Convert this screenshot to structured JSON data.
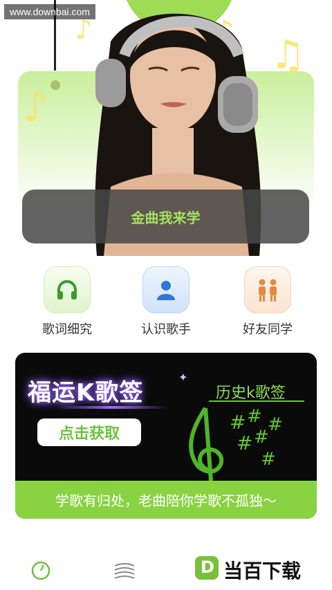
{
  "watermark": "www.downbai.com",
  "hero": {
    "banner_text": "金曲我来学"
  },
  "features": [
    {
      "label": "歌词细究",
      "icon": "headphones-icon"
    },
    {
      "label": "认识歌手",
      "icon": "person-icon"
    },
    {
      "label": "好友同学",
      "icon": "friends-icon"
    }
  ],
  "promo": {
    "title": "福运K歌签",
    "button_label": "点击获取",
    "history_label": "历史k歌签",
    "footer_text": "学歌有归处，老曲陪你学歌不孤独～"
  },
  "bottom": {
    "logo_letter": "D",
    "logo_text": "当百下载"
  },
  "colors": {
    "accent": "#89d342",
    "dark": "#0a0a0a"
  }
}
